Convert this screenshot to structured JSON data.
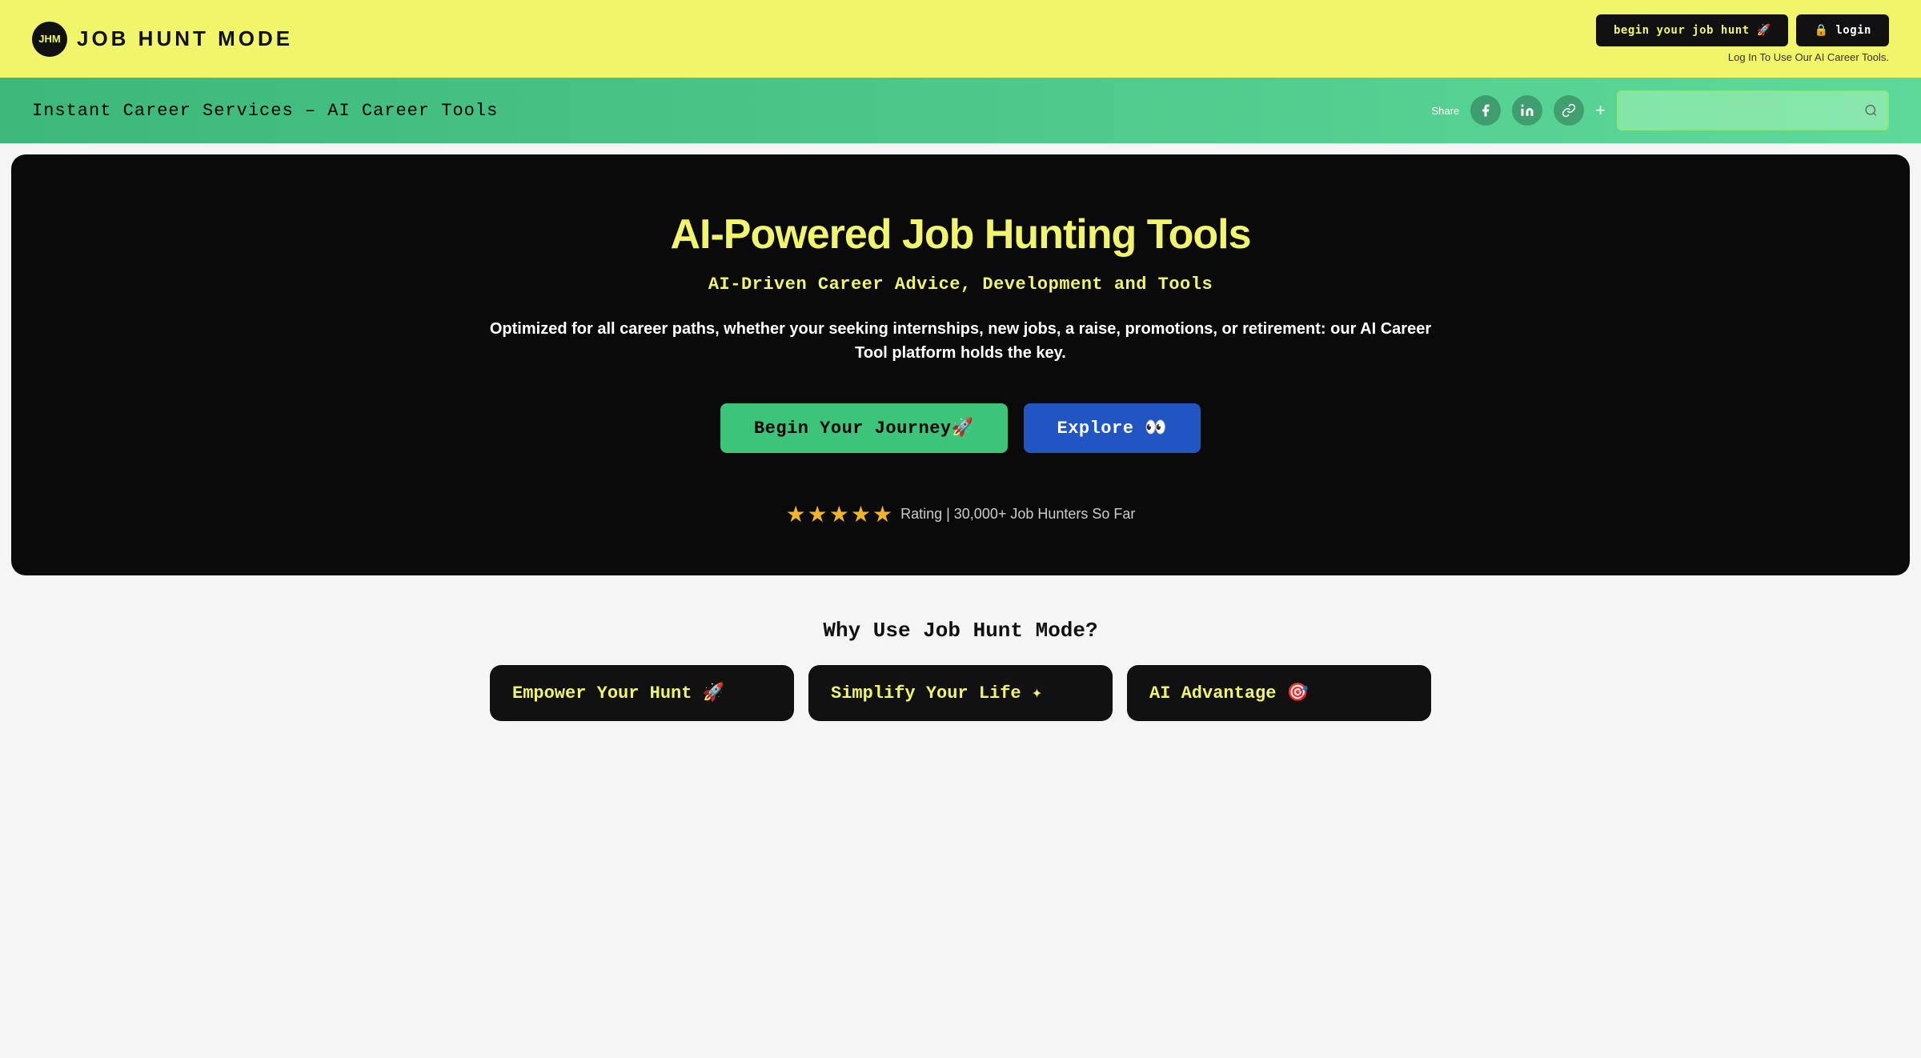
{
  "nav": {
    "logo_text": "JHM",
    "site_name": "JOB HUNT MODE",
    "begin_btn": "begin your job hunt 🚀",
    "login_btn": "🔒 login",
    "nav_subtext": "Log In To Use Our AI Career Tools."
  },
  "share_bar": {
    "title": "Instant Career Services – AI Career Tools",
    "share_label": "Share",
    "plus_icon": "+",
    "search_placeholder": ""
  },
  "hero": {
    "title": "AI-Powered Job Hunting Tools",
    "subtitle": "AI-Driven Career Advice, Development and Tools",
    "description": "Optimized for all career paths, whether your seeking internships, new jobs, a raise, promotions, or retirement: our AI Career Tool platform holds the key.",
    "begin_btn": "Begin Your Journey🚀",
    "explore_btn": "Explore 👀",
    "stars": "★★★★★",
    "rating_text": "Rating | 30,000+ Job Hunters So Far"
  },
  "why_section": {
    "title": "Why Use Job Hunt Mode?",
    "cards": [
      {
        "label": "Empower Your Hunt 🚀"
      },
      {
        "label": "Simplify Your Life ✦"
      },
      {
        "label": "AI Advantage 🎯"
      }
    ]
  }
}
